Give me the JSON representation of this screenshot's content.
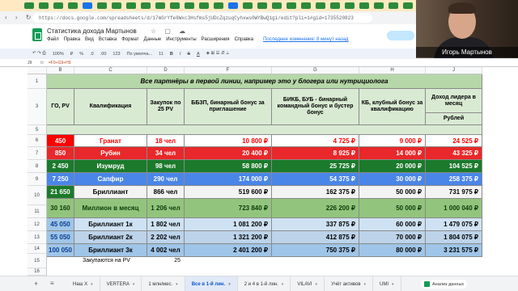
{
  "browser": {
    "url": "https://docs.google.com/spreadsheets/d/17mGrYfe8Wxc3Hsfms5jUDcZqzuqCyhxwsOWYBwQ1gi/edit?pli=1#gid=1735520823"
  },
  "app": {
    "doc_title": "Статистика дохода Мартынов",
    "menus": [
      "Файл",
      "Правка",
      "Вид",
      "Вставка",
      "Формат",
      "Данные",
      "Инструменты",
      "Расширения",
      "Справка"
    ],
    "last_edit": "Последнее изменение: 8 минут назад"
  },
  "toolbar": {
    "zoom": "100%",
    "currency": "₽",
    "percent": "%",
    "dec1": ".0",
    "dec2": ".00",
    "format": "123",
    "font": "По умолча...",
    "size": "11",
    "bold": "B",
    "italic": "I",
    "strike": "S",
    "color": "A"
  },
  "formula_bar": {
    "cell": "J9",
    "content": "=F9+G9+H9"
  },
  "grid": {
    "columns": [
      "A",
      "B",
      "C",
      "D",
      "E",
      "F",
      "G",
      "H",
      "I",
      "J"
    ],
    "rows": [
      "1",
      "2",
      "3",
      "4",
      "5",
      "6",
      "7",
      "8",
      "9",
      "10",
      "11",
      "12",
      "13",
      "14",
      "15",
      "16",
      "17"
    ]
  },
  "table": {
    "banner": "Все партнёры в первой линии, например это у блогера или нутрициолога",
    "headers": {
      "go_pv": "ГО, PV",
      "qual": "Квалификация",
      "purchase": "Закупок по 25 PV",
      "bbzp": "ББЗП, бинарный бонус за приглашение",
      "bikb": "БИКБ, БУБ - бинарный командный бонус и бустер бонус",
      "kb": "КБ, клубный бонус за квалификацию",
      "income": "Доход лидера в месяц",
      "rub": "Рублей"
    },
    "rows": [
      {
        "go": "450",
        "qual": "Гранат",
        "purchase": "18 чел",
        "bbzp": "10 800 ₽",
        "bikb": "4 725 ₽",
        "kb": "9 000 ₽",
        "income": "24 525 ₽"
      },
      {
        "go": "850",
        "qual": "Рубин",
        "purchase": "34 чел",
        "bbzp": "20 400 ₽",
        "bikb": "8 925 ₽",
        "kb": "14 000 ₽",
        "income": "43 325 ₽"
      },
      {
        "go": "2 450",
        "qual": "Изумруд",
        "purchase": "98 чел",
        "bbzp": "58 800 ₽",
        "bikb": "25 725 ₽",
        "kb": "20 000 ₽",
        "income": "104 525 ₽"
      },
      {
        "go": "7 250",
        "qual": "Сапфир",
        "purchase": "290 чел",
        "bbzp": "174 000 ₽",
        "bikb": "54 375 ₽",
        "kb": "30 000 ₽",
        "income": "258 375 ₽"
      },
      {
        "go": "21 650",
        "qual": "Бриллиант",
        "purchase": "866 чел",
        "bbzp": "519 600 ₽",
        "bikb": "162 375 ₽",
        "kb": "50 000 ₽",
        "income": "731 975 ₽"
      },
      {
        "go": "30 160",
        "qual": "Миллион в месяц",
        "purchase": "1 206 чел",
        "bbzp": "723 840 ₽",
        "bikb": "226 200 ₽",
        "kb": "50 000 ₽",
        "income": "1 000 040 ₽"
      },
      {
        "go": "45 050",
        "qual": "Бриллиант 1к",
        "purchase": "1 802 чел",
        "bbzp": "1 081 200 ₽",
        "bikb": "337 875 ₽",
        "kb": "60 000 ₽",
        "income": "1 479 075 ₽"
      },
      {
        "go": "55 050",
        "qual": "Бриллиант 2к",
        "purchase": "2 202 чел",
        "bbzp": "1 321 200 ₽",
        "bikb": "412 875 ₽",
        "kb": "70 000 ₽",
        "income": "1 804 075 ₽"
      },
      {
        "go": "100 050",
        "qual": "Бриллиант 3к",
        "purchase": "4 002 чел",
        "bbzp": "2 401 200 ₽",
        "bikb": "750 375 ₽",
        "kb": "80 000 ₽",
        "income": "3 231 575 ₽"
      }
    ],
    "footer_label": "Закупаются на PV",
    "footer_value": "25"
  },
  "sheet_tabs": [
    "Наш Х",
    "VERTERA",
    "1 млн/мес.",
    "Все в 1-й лин.",
    "2 и 4 в 1-й лин.",
    "VILAVI",
    "Учёт активов",
    "UMI"
  ],
  "active_tab_index": 3,
  "explore_label": "Анализ данных",
  "webcam": {
    "name": "Игорь Мартынов"
  },
  "colors": {
    "header_green": "#b6d7a8",
    "light_green": "#d9ead3",
    "granat_text": "#ff0000",
    "ruby_bg": "#e8282a",
    "emerald_bg": "#1b7a2b",
    "sapphire_bg": "#4a86e8",
    "diamond_bg": "#f3f3f3",
    "million_bg": "#93c47d",
    "d1_bg": "#cfe2f3",
    "d2_bg": "#bcd3ea",
    "d3_bg": "#9fc5e8",
    "ruble_red": "#e02020"
  }
}
